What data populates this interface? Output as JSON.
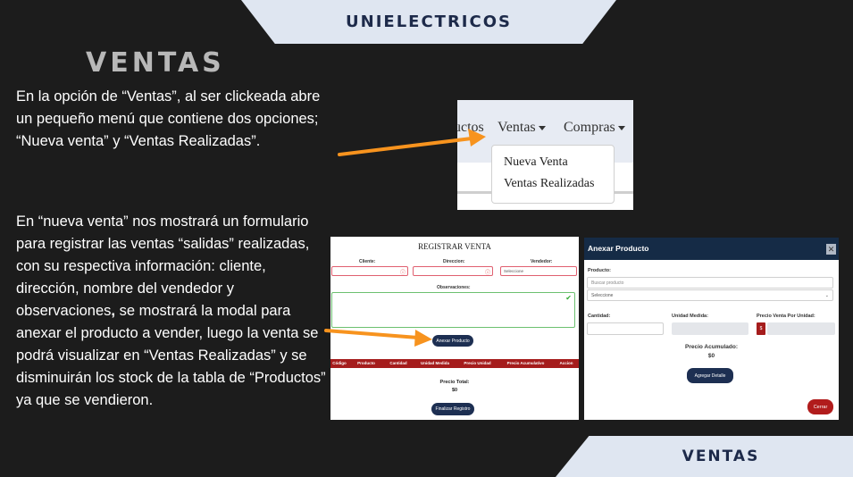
{
  "header": {
    "brand": "UNIELECTRICOS"
  },
  "footer": {
    "section": "VENTAS"
  },
  "title": "VENTAS",
  "paragraph1": "En la opción de “Ventas”,  al ser clickeada abre un pequeño menú que contiene dos opciones; “Nueva venta” y “Ventas Realizadas”.",
  "paragraph2": {
    "part1": "En “nueva venta” nos mostrará un formulario para registrar las ventas “salidas” realizadas, con su respectiva información: cliente, dirección, nombre del vendedor y observaciones",
    "comma": ",",
    "part2": " se mostrará la modal para anexar el producto a vender, luego la venta se podrá visualizar en “Ventas Realizadas” y se disminuirán los stock de la tabla de “Productos” ya que se vendieron."
  },
  "menu_shot": {
    "nav_items": [
      "uctos",
      "Ventas",
      "Compras"
    ],
    "dropdown": [
      "Nueva Venta",
      "Ventas Realizadas"
    ]
  },
  "form_shot": {
    "title": "REGISTRAR VENTA",
    "labels": {
      "client": "Cliente:",
      "address": "Direccion:",
      "seller": "Vendedor:",
      "notes": "Observaciones:"
    },
    "seller_select": "Seleccione",
    "add_product": "Anexar Producto",
    "columns": [
      "Código",
      "Producto",
      "Cantidad",
      "Unidad Medida",
      "Precio Unidad",
      "Precio Acumulativo",
      "Accion"
    ],
    "total_label": "Precio Total:",
    "total_value": "$0",
    "finish": "Finalizar Registro"
  },
  "modal_shot": {
    "title": "Anexar Producto",
    "close_x": "✕",
    "product_label": "Producto:",
    "search_placeholder": "Buscar producto",
    "select": "Seleccione",
    "qty_label": "Cantidad:",
    "unit_label": "Unidad Medida:",
    "price_label": "Precio Venta Por Unidad:",
    "currency": "$",
    "acc_label": "Precio Acumulado:",
    "acc_value": "$0",
    "add_detail": "Agregar Detalle",
    "close": "Cerrar"
  },
  "colors": {
    "accent": "#f7931e",
    "navy": "#1d2f52",
    "red": "#a51c1c",
    "panel": "#dfe6f1"
  }
}
